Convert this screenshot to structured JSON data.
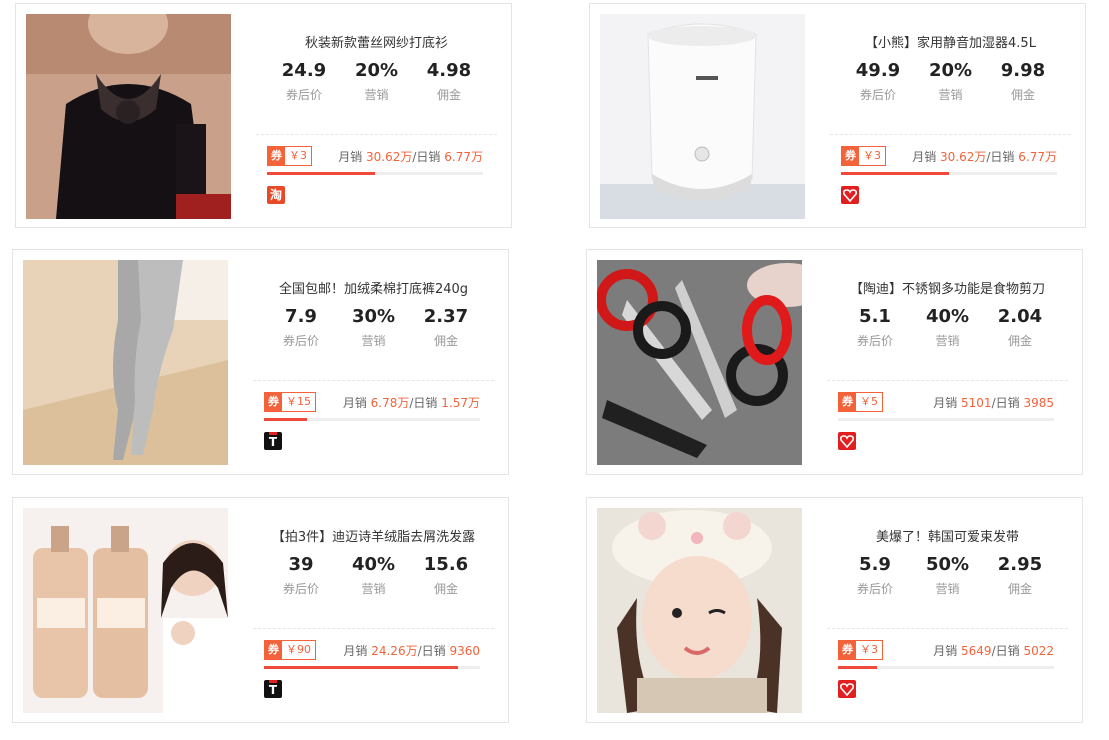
{
  "labels": {
    "price": "券后价",
    "rate": "营销",
    "commission": "佣金",
    "coupon_tag": "券",
    "monthly": "月销",
    "daily": "/日销"
  },
  "products": [
    {
      "title": "秋装新款蕾丝网纱打底衫",
      "price": "24.9",
      "rate": "20%",
      "commission": "4.98",
      "coupon": "￥3",
      "monthly": "30.62万",
      "daily": "6.77万",
      "progress": 0.5,
      "platform": "淘",
      "platform_icon": "taobao-icon",
      "image": "black lace blouse model"
    },
    {
      "title": "【小熊】家用静音加湿器4.5L",
      "price": "49.9",
      "rate": "20%",
      "commission": "9.98",
      "coupon": "￥3",
      "monthly": "30.62万",
      "daily": "6.77万",
      "progress": 0.5,
      "platform": "",
      "platform_icon": "pinduoduo-icon",
      "image": "white humidifier"
    },
    {
      "title": "全国包邮！加绒柔棉打底裤240g",
      "price": "7.9",
      "rate": "30%",
      "commission": "2.37",
      "coupon": "￥15",
      "monthly": "6.78万",
      "daily": "1.57万",
      "progress": 0.2,
      "platform": "T",
      "platform_icon": "tmall-icon",
      "image": "grey leggings"
    },
    {
      "title": "【陶迪】不锈钢多功能是食物剪刀",
      "price": "5.1",
      "rate": "40%",
      "commission": "2.04",
      "coupon": "￥5",
      "monthly": "5101",
      "daily": "3985",
      "progress": 0.0,
      "platform": "",
      "platform_icon": "pinduoduo-icon",
      "image": "kitchen scissors"
    },
    {
      "title": "【拍3件】迪迈诗羊绒脂去屑洗发露",
      "price": "39",
      "rate": "40%",
      "commission": "15.6",
      "coupon": "￥90",
      "monthly": "24.26万",
      "daily": "9360",
      "progress": 0.9,
      "platform": "T",
      "platform_icon": "tmall-icon",
      "image": "shampoo bottles with model"
    },
    {
      "title": "美爆了！韩国可爱束发带",
      "price": "5.9",
      "rate": "50%",
      "commission": "2.95",
      "coupon": "￥3",
      "monthly": "5649",
      "daily": "5022",
      "progress": 0.18,
      "platform": "",
      "platform_icon": "pinduoduo-icon",
      "image": "girl with mouse headband"
    }
  ]
}
